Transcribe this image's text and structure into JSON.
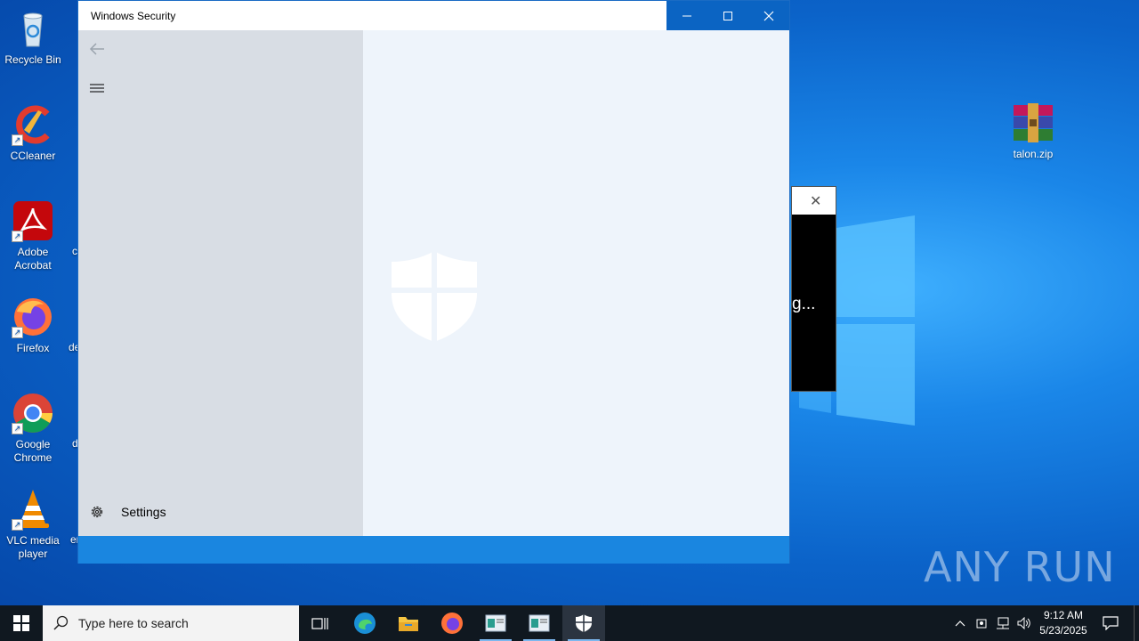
{
  "desktop": {
    "icons": [
      {
        "label": "Recycle Bin"
      },
      {
        "label": "CCleaner"
      },
      {
        "label": "Adobe\nAcrobat"
      },
      {
        "label": "Firefox"
      },
      {
        "label": "Google\nChrome"
      },
      {
        "label": "VLC media\nplayer"
      }
    ],
    "clipped_labels": [
      "c",
      "de",
      "d",
      "er"
    ],
    "file": {
      "label": "talon.zip"
    }
  },
  "window": {
    "title": "Windows Security",
    "nav": {
      "settings_label": "Settings"
    },
    "colors": {
      "accent": "#0b64c3",
      "statusbar": "#1a86e0",
      "nav_bg": "#d8dde4",
      "content_bg": "#eef4fb"
    }
  },
  "popup": {
    "text": "g..."
  },
  "watermark": "ANY RUN",
  "taskbar": {
    "search_placeholder": "Type here to search",
    "clock_time": "9:12 AM",
    "clock_date": "5/23/2025"
  }
}
